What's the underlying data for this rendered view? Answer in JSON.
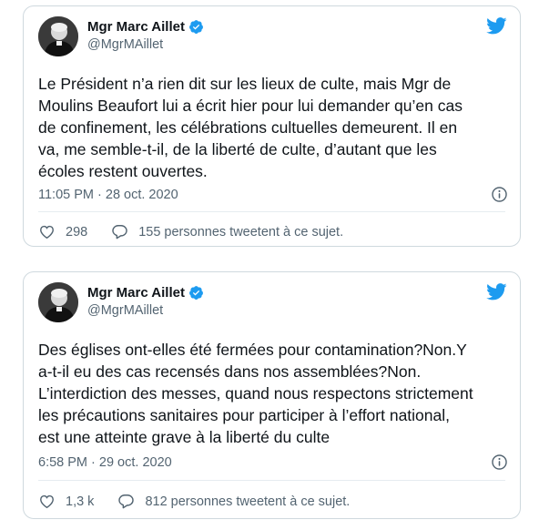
{
  "colors": {
    "accent": "#1d9bf0",
    "secondary_text": "#536471",
    "border": "#cfd9de"
  },
  "tweets": [
    {
      "author_name": "Mgr Marc Aillet",
      "handle": "@MgrMAillet",
      "verified_icon": "verified-badge-icon",
      "text": "Le Président n’a rien dit sur les lieux de culte, mais Mgr de\nMoulins Beaufort lui a écrit hier pour lui demander qu’en cas\nde confinement, les célébrations cultuelles demeurent. Il en\nva, me semble-t-il, de la liberté de culte, d’autant que les\nécoles restent ouvertes.",
      "timestamp": "11:05 PM · 28 oct. 2020",
      "likes": "298",
      "discussion": "155 personnes tweetent à ce sujet."
    },
    {
      "author_name": "Mgr Marc Aillet",
      "handle": "@MgrMAillet",
      "verified_icon": "verified-badge-icon",
      "text": "Des églises ont-elles été fermées pour contamination?Non.Y\na-t-il eu des cas recensés dans nos assemblées?Non.\nL’interdiction des messes, quand nous respectons strictement\nles précautions sanitaires pour participer à l’effort national,\nest une atteinte grave à la liberté du culte",
      "timestamp": "6:58 PM · 29 oct. 2020",
      "likes": "1,3 k",
      "discussion": "812 personnes tweetent à ce sujet."
    }
  ]
}
